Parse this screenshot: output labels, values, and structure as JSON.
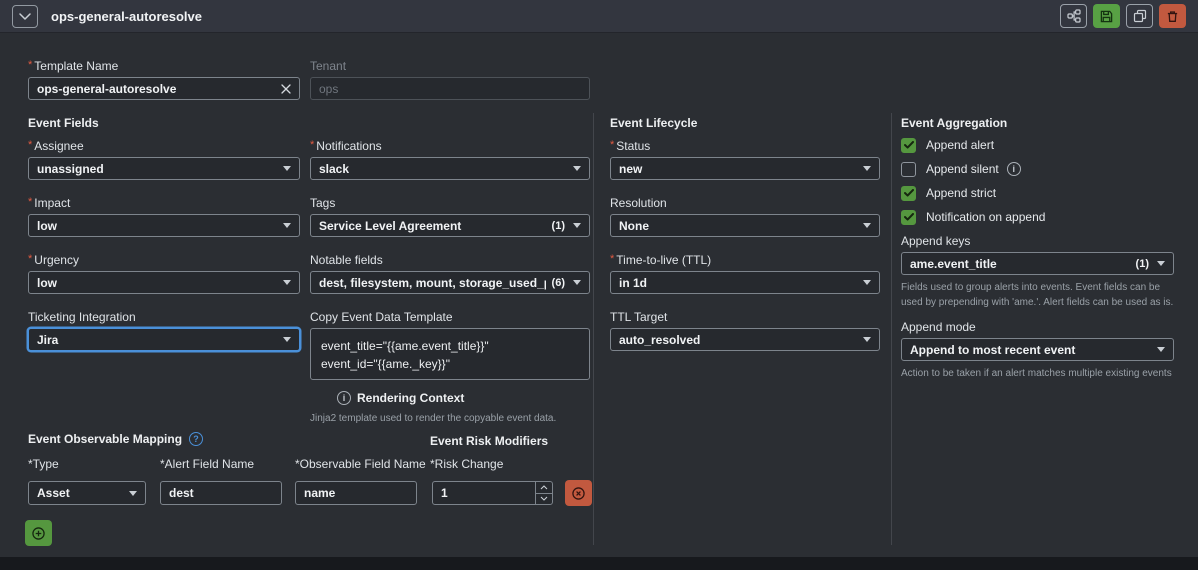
{
  "ui": {
    "required_marker": "*"
  },
  "colors": {
    "accent_green": "#58a144",
    "accent_red": "#c2593f",
    "focus_blue": "#4a90d9",
    "required_red": "#e25a41",
    "content_bg": "#2b2e33",
    "titlebar_bg": "#33363f"
  },
  "icons": {
    "collapse": "chevron-down",
    "workflow": "flow-chart",
    "save": "floppy-disk",
    "copy": "duplicate",
    "delete": "trash",
    "clear": "x",
    "dropdown": "caret-down",
    "info": "info-circle",
    "help": "question-circle",
    "add": "add-circle",
    "remove": "remove-circle"
  },
  "header": {
    "title": "ops-general-autoresolve"
  },
  "template_name": {
    "label": "Template Name",
    "value": "ops-general-autoresolve"
  },
  "tenant": {
    "label": "Tenant",
    "placeholder": "ops"
  },
  "event_fields": {
    "title": "Event Fields",
    "assignee": {
      "label": "Assignee",
      "value": "unassigned"
    },
    "impact": {
      "label": "Impact",
      "value": "low"
    },
    "urgency": {
      "label": "Urgency",
      "value": "low"
    },
    "ticketing_integration": {
      "label": "Ticketing Integration",
      "value": "Jira"
    },
    "notifications": {
      "label": "Notifications",
      "value": "slack"
    },
    "tags": {
      "label": "Tags",
      "value": "Service Level Agreement",
      "count": "(1)"
    },
    "notable_fields": {
      "label": "Notable fields",
      "value": "dest, filesystem, mount, storage_used_percent...",
      "count": "(6)"
    },
    "copy_event_data_template": {
      "label": "Copy Event Data Template",
      "lines": [
        "event_title=\"{{ame.event_title}}\"",
        "event_id=\"{{ame._key}}\""
      ],
      "rendering_context_label": "Rendering Context",
      "help": "Jinja2 template used to render the copyable event data."
    }
  },
  "event_lifecycle": {
    "title": "Event Lifecycle",
    "status": {
      "label": "Status",
      "value": "new"
    },
    "resolution": {
      "label": "Resolution",
      "value": "None"
    },
    "ttl": {
      "label": "Time-to-live (TTL)",
      "value": "in 1d"
    },
    "ttl_target": {
      "label": "TTL Target",
      "value": "auto_resolved"
    }
  },
  "event_aggregation": {
    "title": "Event Aggregation",
    "append_alert": {
      "label": "Append alert",
      "checked": true
    },
    "append_silent": {
      "label": "Append silent",
      "checked": false
    },
    "append_strict": {
      "label": "Append strict",
      "checked": true
    },
    "notification_on_append": {
      "label": "Notification on append",
      "checked": true
    },
    "append_keys": {
      "label": "Append keys",
      "value": "ame.event_title",
      "count": "(1)",
      "help": "Fields used to group alerts into events. Event fields can be used by prepending with 'ame.'. Alert fields can be used as is."
    },
    "append_mode": {
      "label": "Append mode",
      "value": "Append to most recent event",
      "help": "Action to be taken if an alert matches multiple existing events"
    }
  },
  "observable_mapping": {
    "title": "Event Observable Mapping",
    "type": {
      "label": "*Type",
      "value": "Asset"
    },
    "alert_field_name": {
      "label": "*Alert Field Name",
      "value": "dest"
    },
    "observable_field_name": {
      "label": "*Observable Field Name",
      "value": "name"
    }
  },
  "risk_modifiers": {
    "title": "Event Risk Modifiers",
    "risk_change": {
      "label": "*Risk Change",
      "value": "1"
    }
  }
}
